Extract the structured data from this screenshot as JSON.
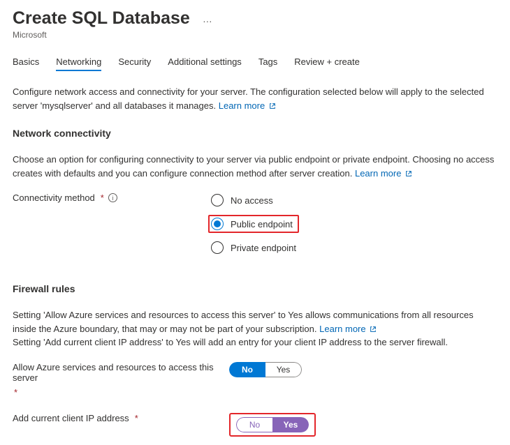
{
  "header": {
    "title": "Create SQL Database",
    "subtitle": "Microsoft"
  },
  "tabs": {
    "basics": "Basics",
    "networking": "Networking",
    "security": "Security",
    "additional": "Additional settings",
    "tags": "Tags",
    "review": "Review + create"
  },
  "intro": {
    "text": "Configure network access and connectivity for your server. The configuration selected below will apply to the selected server 'mysqlserver' and all databases it manages.",
    "learn_more": "Learn more"
  },
  "connectivity": {
    "heading": "Network connectivity",
    "desc": "Choose an option for configuring connectivity to your server via public endpoint or private endpoint. Choosing no access creates with defaults and you can configure connection method after server creation.",
    "learn_more": "Learn more",
    "label": "Connectivity method",
    "options": {
      "none": "No access",
      "public": "Public endpoint",
      "private": "Private endpoint"
    }
  },
  "firewall": {
    "heading": "Firewall rules",
    "desc1": "Setting 'Allow Azure services and resources to access this server' to Yes allows communications from all resources inside the Azure boundary, that may or may not be part of your subscription.",
    "learn_more": "Learn more",
    "desc2": "Setting 'Add current client IP address' to Yes will add an entry for your client IP address to the server firewall.",
    "allow_azure_label": "Allow Azure services and resources to access this server",
    "add_ip_label": "Add current client IP address",
    "no": "No",
    "yes": "Yes"
  }
}
